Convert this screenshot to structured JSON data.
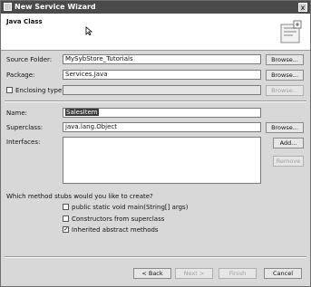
{
  "window": {
    "title": "New Service Wizard",
    "close_label": "x"
  },
  "banner": {
    "heading": "Java Class"
  },
  "form": {
    "source_folder": {
      "label": "Source Folder:",
      "value": "MySybStore_Tutorials",
      "browse": "Browse..."
    },
    "package": {
      "label": "Package:",
      "value": "Services.Java",
      "browse": "Browse..."
    },
    "enclosing_type": {
      "label": "Enclosing type:",
      "value": "",
      "checked": false,
      "browse": "Browse..."
    },
    "name": {
      "label": "Name:",
      "value": "SalesItem"
    },
    "superclass": {
      "label": "Superclass:",
      "value": "java.lang.Object",
      "browse": "Browse..."
    },
    "interfaces": {
      "label": "Interfaces:",
      "add": "Add...",
      "remove": "Remove"
    }
  },
  "stubs": {
    "question": "Which method stubs would you like to create?",
    "options": [
      {
        "label": "public static void main(String[] args)",
        "checked": false
      },
      {
        "label": "Constructors from superclass",
        "checked": false
      },
      {
        "label": "Inherited abstract methods",
        "checked": true
      }
    ]
  },
  "footer": {
    "back": "< Back",
    "next": "Next >",
    "finish": "Finish",
    "cancel": "Cancel"
  }
}
